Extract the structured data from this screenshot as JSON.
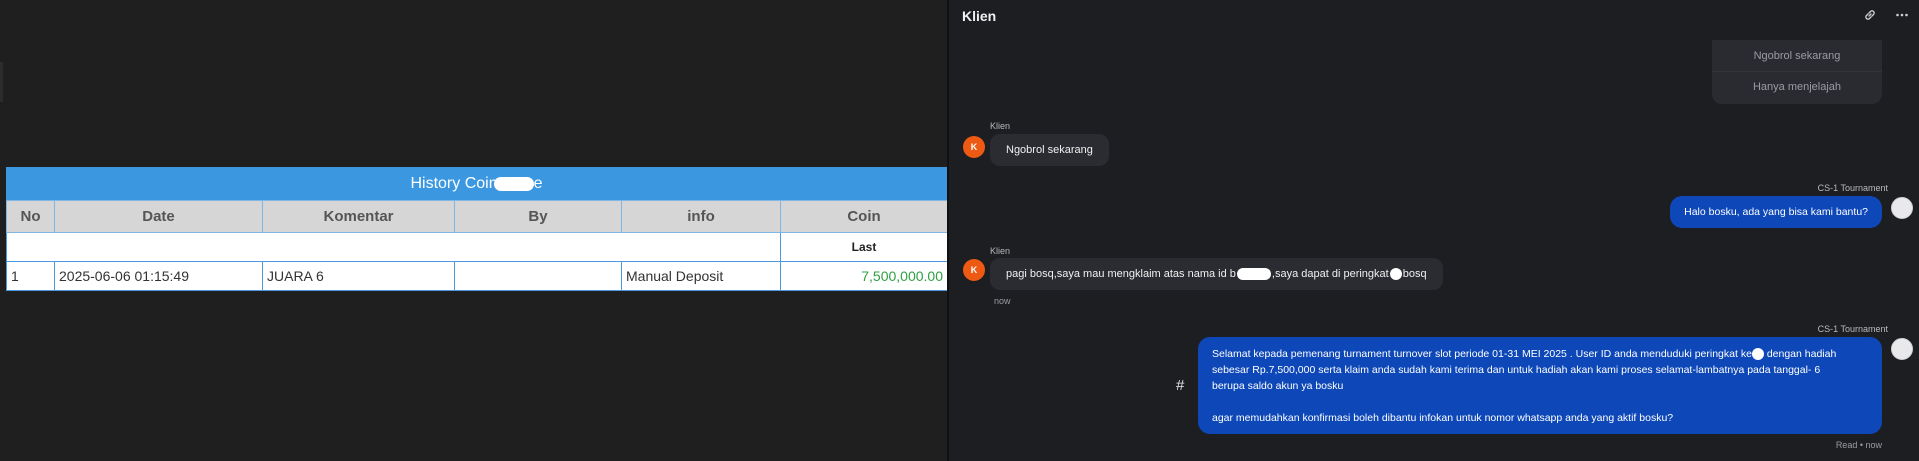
{
  "left": {
    "table_title": "History Coin ",
    "title_suffix": "e",
    "columns": [
      "No",
      "Date",
      "Komentar",
      "By",
      "info",
      "Coin"
    ],
    "subheader_last": "Last",
    "rows": [
      {
        "no": "1",
        "date": "2025-06-06 01:15:49",
        "komentar": "JUARA 6",
        "by": "",
        "info": "Manual Deposit",
        "coin": "7,500,000.00"
      }
    ]
  },
  "chat": {
    "header_title": "Klien",
    "quick_replies": [
      "Ngobrol sekarang",
      "Hanya menjelajah"
    ],
    "messages": [
      {
        "sender": "Klien",
        "avatar": "K",
        "text": "Ngobrol sekarang"
      },
      {
        "sender": "CS-1 Tournament",
        "text": "Halo bosku, ada yang bisa kami bantu?"
      },
      {
        "sender": "Klien",
        "avatar": "K",
        "text_a": "pagi bosq,saya mau mengklaim atas nama id b",
        "text_b": ",saya dapat di peringkat",
        "text_c": "bosq",
        "time": "now"
      },
      {
        "sender": "CS-1 Tournament",
        "line1a": "Selamat kepada pemenang turnament turnover slot periode 01-31 MEI 2025 . User ID anda menduduki peringkat ke",
        "line1b": "dengan hadiah",
        "line2": "sebesar Rp.7,500,000 serta klaim anda sudah kami terima dan untuk hadiah akan kami proses selamat-lambatnya pada tanggal- 6",
        "line3": "berupa saldo akun ya bosku",
        "line4": "agar memudahkan konfirmasi boleh dibantu infokan untuk nomor whatsapp anda yang aktif bosku?",
        "status": "Read • now"
      }
    ],
    "hash_symbol": "#"
  },
  "icons": [
    "link-icon",
    "more-icon"
  ]
}
